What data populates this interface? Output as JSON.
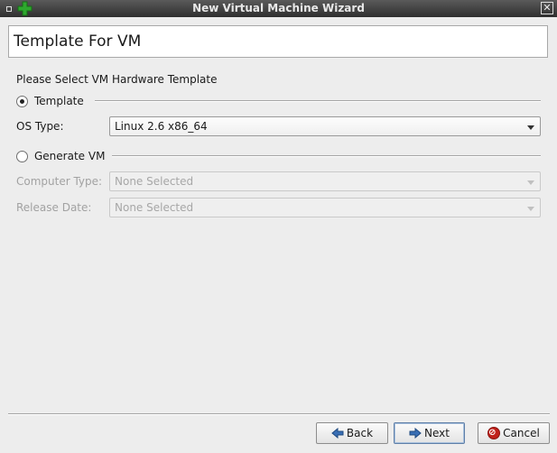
{
  "window": {
    "title": "New Virtual Machine Wizard"
  },
  "header": {
    "title": "Template For VM"
  },
  "form": {
    "section_title": "Please Select VM Hardware Template",
    "template_option": {
      "label": "Template",
      "selected": true
    },
    "os_type": {
      "label": "OS Type:",
      "value": "Linux 2.6 x86_64"
    },
    "generate_option": {
      "label": "Generate VM",
      "selected": false
    },
    "computer_type": {
      "label": "Computer Type:",
      "value": "None Selected",
      "enabled": false
    },
    "release_date": {
      "label": "Release Date:",
      "value": "None Selected",
      "enabled": false
    }
  },
  "buttons": {
    "back": "Back",
    "next": "Next",
    "cancel": "Cancel"
  },
  "icons": {
    "app": "green-plus-icon",
    "back": "left-arrow-icon",
    "next": "right-arrow-icon",
    "cancel": "stop-icon"
  },
  "colors": {
    "accent_green": "#2ea82e",
    "arrow_blue": "#3a6fb5",
    "cancel_red": "#c0201a"
  }
}
